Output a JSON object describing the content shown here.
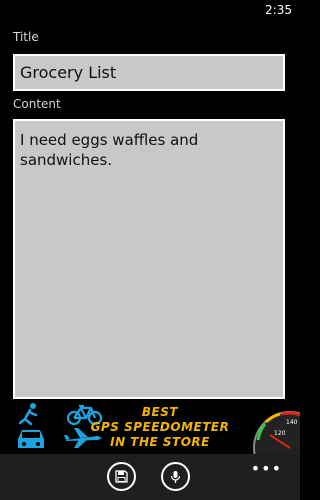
{
  "status_bar": {
    "time": "2:35"
  },
  "form": {
    "title_label": "Title",
    "title_value": "Grocery List",
    "content_label": "Content",
    "content_value": "I need eggs waffles and sandwiches."
  },
  "ad": {
    "line1": "BEST",
    "line2": "GPS SPEEDOMETER",
    "line3": "IN THE STORE",
    "accent_color": "#f5b400",
    "icon_color": "#1fa3e0",
    "gauge_ticks": [
      "120",
      "140"
    ],
    "icons": [
      "runner-icon",
      "bicycle-icon",
      "car-icon",
      "airplane-icon",
      "speedometer-icon"
    ]
  },
  "app_bar": {
    "buttons": [
      "save-icon",
      "microphone-icon"
    ],
    "more_label": "•••"
  }
}
